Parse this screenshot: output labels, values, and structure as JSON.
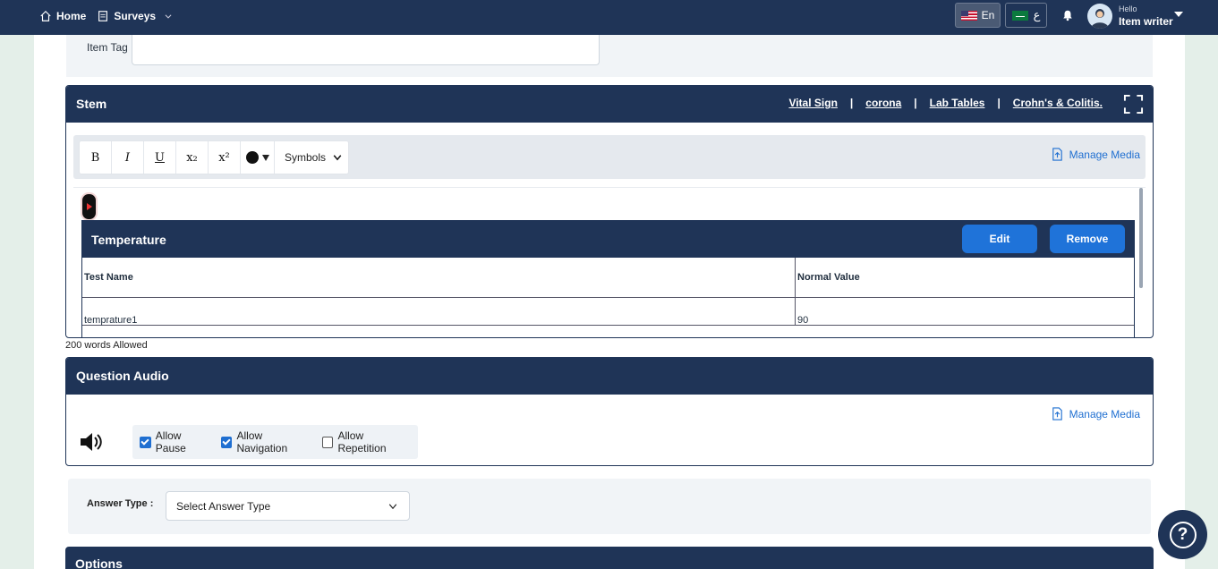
{
  "topbar": {
    "home": "Home",
    "surveys": "Surveys",
    "lang_en": "En",
    "lang_ar": "ع",
    "hello": "Hello",
    "user": "Item writer"
  },
  "item_tag": {
    "label": "Item Tag",
    "value": ""
  },
  "stem": {
    "title": "Stem",
    "links": [
      "Vital Sign",
      "corona",
      "Lab Tables",
      "Crohn's & Colitis."
    ],
    "separator": "|",
    "toolbar": {
      "bold": "B",
      "italic": "I",
      "underline": "U",
      "subscript": "x₂",
      "superscript": "x²",
      "symbols": "Symbols"
    },
    "manage_media": "Manage Media",
    "lab_table": {
      "title": "Temperature",
      "edit": "Edit",
      "remove": "Remove",
      "col1": "Test Name",
      "col2": "Normal Value",
      "row1": {
        "name": "temprature1",
        "value": "90"
      }
    },
    "words_allowed": "200 words Allowed"
  },
  "audio": {
    "title": "Question Audio",
    "manage_media": "Manage Media",
    "options": [
      {
        "label": "Allow Pause",
        "checked": true
      },
      {
        "label": "Allow Navigation",
        "checked": true
      },
      {
        "label": "Allow Repetition",
        "checked": false
      }
    ]
  },
  "answer": {
    "label": "Answer Type :",
    "placeholder": "Select Answer Type"
  },
  "options": {
    "title": "Options"
  },
  "help": {
    "label": "?"
  },
  "colors": {
    "navy": "#1f3457",
    "accent": "#1f73d9"
  }
}
